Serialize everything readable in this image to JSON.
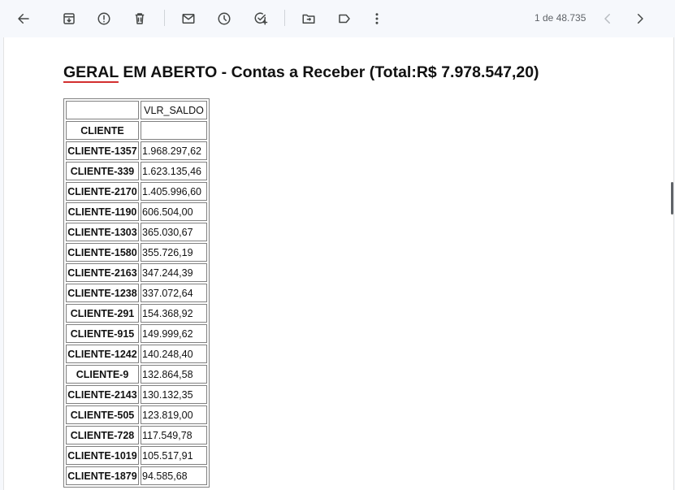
{
  "toolbar": {
    "buttons": [
      {
        "name": "back-button",
        "icon": "arrow-left-icon"
      },
      {
        "name": "archive-button",
        "icon": "archive-icon"
      },
      {
        "name": "report-spam-button",
        "icon": "alert-circle-icon"
      },
      {
        "name": "delete-button",
        "icon": "trash-icon"
      },
      {
        "name": "mark-unread-button",
        "icon": "mail-icon"
      },
      {
        "name": "snooze-button",
        "icon": "clock-icon"
      },
      {
        "name": "add-task-button",
        "icon": "task-add-icon"
      },
      {
        "name": "move-to-button",
        "icon": "folder-move-icon"
      },
      {
        "name": "label-button",
        "icon": "label-icon"
      },
      {
        "name": "more-button",
        "icon": "more-vert-icon"
      }
    ],
    "pager": {
      "text": "1 de 48.735"
    }
  },
  "email": {
    "title_underlined": "GERAL",
    "title_rest": " EM ABERTO - Contas a Receber (Total:R$ 7.978.547,20)",
    "table": {
      "header_top": [
        "",
        "VLR_SALDO"
      ],
      "header_second": [
        "CLIENTE",
        ""
      ],
      "rows": [
        [
          "CLIENTE-1357",
          "1.968.297,62"
        ],
        [
          "CLIENTE-339",
          "1.623.135,46"
        ],
        [
          "CLIENTE-2170",
          "1.405.996,60"
        ],
        [
          "CLIENTE-1190",
          "606.504,00"
        ],
        [
          "CLIENTE-1303",
          "365.030,67"
        ],
        [
          "CLIENTE-1580",
          "355.726,19"
        ],
        [
          "CLIENTE-2163",
          "347.244,39"
        ],
        [
          "CLIENTE-1238",
          "337.072,64"
        ],
        [
          "CLIENTE-291",
          "154.368,92"
        ],
        [
          "CLIENTE-915",
          "149.999,62"
        ],
        [
          "CLIENTE-1242",
          "140.248,40"
        ],
        [
          "CLIENTE-9",
          "132.864,58"
        ],
        [
          "CLIENTE-2143",
          "130.132,35"
        ],
        [
          "CLIENTE-505",
          "123.819,00"
        ],
        [
          "CLIENTE-728",
          "117.549,78"
        ],
        [
          "CLIENTE-1019",
          "105.517,91"
        ],
        [
          "CLIENTE-1879",
          "94.585,68"
        ]
      ]
    }
  }
}
